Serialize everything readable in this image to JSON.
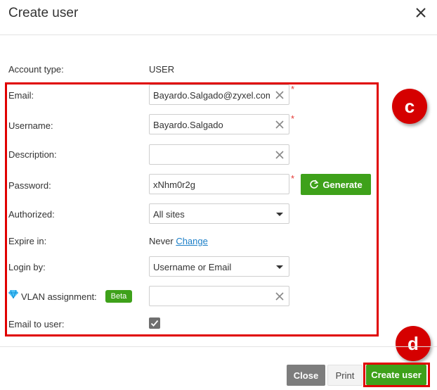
{
  "dialog": {
    "title": "Create user"
  },
  "form": {
    "account_type": {
      "label": "Account type:",
      "value": "USER"
    },
    "email": {
      "label": "Email:",
      "value": "Bayardo.Salgado@zyxel.com"
    },
    "username": {
      "label": "Username:",
      "value": "Bayardo.Salgado"
    },
    "description": {
      "label": "Description:",
      "value": ""
    },
    "password": {
      "label": "Password:",
      "value": "xNhm0r2g",
      "generate_label": "Generate"
    },
    "authorized": {
      "label": "Authorized:",
      "value": "All sites"
    },
    "expire_in": {
      "label": "Expire in:",
      "value": "Never",
      "change_link": "Change"
    },
    "login_by": {
      "label": "Login by:",
      "value": "Username or Email"
    },
    "vlan": {
      "label": "VLAN assignment:",
      "badge": "Beta",
      "value": ""
    },
    "email_to_user": {
      "label": "Email to user:",
      "checked": true
    },
    "required_mark": "*"
  },
  "annotations": {
    "c": "c",
    "d": "d",
    "highlight_color": "#e00000"
  },
  "footer": {
    "close_label": "Close",
    "print_label": "Print",
    "create_label": "Create user"
  },
  "colors": {
    "accent_green": "#3ea11a",
    "link_blue": "#1c7fc8",
    "required_red": "#e53935"
  }
}
